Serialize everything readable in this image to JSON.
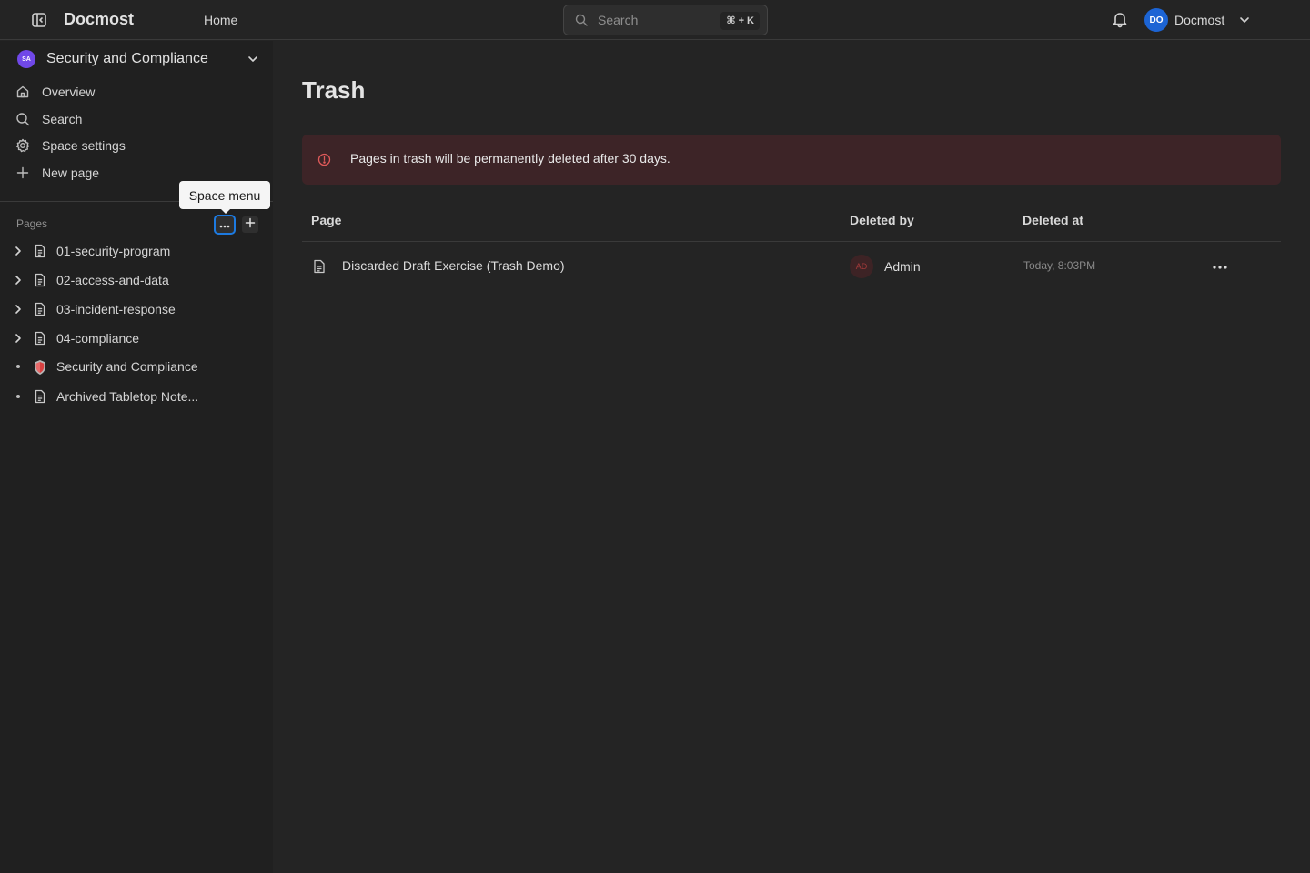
{
  "header": {
    "brand": "Docmost",
    "nav_home": "Home",
    "search_placeholder": "Search",
    "search_shortcut": "⌘ + K",
    "user_initials": "DO",
    "user_name": "Docmost",
    "user_avatar_color": "#1c64d4"
  },
  "sidebar": {
    "space": {
      "initials": "SA",
      "name": "Security and Compliance",
      "avatar_color": "#7048e8"
    },
    "nav": [
      {
        "label": "Overview",
        "icon": "home-icon"
      },
      {
        "label": "Search",
        "icon": "search-icon"
      },
      {
        "label": "Space settings",
        "icon": "gear-icon"
      },
      {
        "label": "New page",
        "icon": "plus-icon"
      }
    ],
    "pages_label": "Pages",
    "tooltip": "Space menu",
    "tree": [
      {
        "label": "01-security-program",
        "expandable": true,
        "icon": "document-icon"
      },
      {
        "label": "02-access-and-data",
        "expandable": true,
        "icon": "document-icon"
      },
      {
        "label": "03-incident-response",
        "expandable": true,
        "icon": "document-icon"
      },
      {
        "label": "04-compliance",
        "expandable": true,
        "icon": "document-icon"
      },
      {
        "label": "Security and Compliance",
        "expandable": false,
        "icon": "shield-emoji-icon"
      },
      {
        "label": "Archived Tabletop Note...",
        "expandable": false,
        "icon": "document-icon"
      }
    ]
  },
  "main": {
    "title": "Trash",
    "alert_text": "Pages in trash will be permanently deleted after 30 days.",
    "alert_color": "#3d2427",
    "table": {
      "headers": {
        "page": "Page",
        "deleted_by": "Deleted by",
        "deleted_at": "Deleted at"
      },
      "rows": [
        {
          "page": "Discarded Draft Exercise (Trash Demo)",
          "avatar_initials": "AD",
          "deleted_by": "Admin",
          "deleted_at": "Today, 8:03PM"
        }
      ]
    }
  },
  "colors": {
    "background": "#242424",
    "sidebar": "#202020",
    "accent": "#1d7ae0"
  }
}
